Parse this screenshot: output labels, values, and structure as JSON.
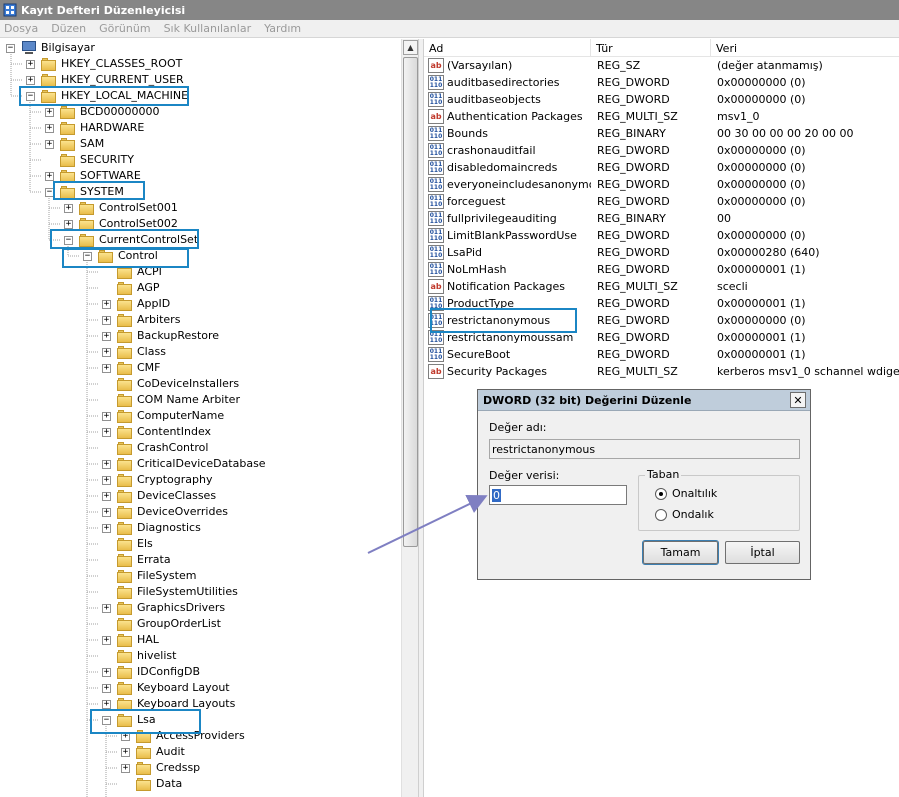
{
  "window": {
    "title": "Kayıt Defteri Düzenleyicisi"
  },
  "menu": [
    "Dosya",
    "Düzen",
    "Görünüm",
    "Sık Kullanılanlar",
    "Yardım"
  ],
  "tree": {
    "root": "Bilgisayar",
    "hives": [
      "HKEY_CLASSES_ROOT",
      "HKEY_CURRENT_USER",
      "HKEY_LOCAL_MACHINE"
    ],
    "hklm_children": [
      "BCD00000000",
      "HARDWARE",
      "SAM",
      "SECURITY",
      "SOFTWARE",
      "SYSTEM"
    ],
    "system_children": [
      "ControlSet001",
      "ControlSet002",
      "CurrentControlSet"
    ],
    "ccs_children": [
      "Control"
    ],
    "control_children": [
      "ACPI",
      "AGP",
      "AppID",
      "Arbiters",
      "BackupRestore",
      "Class",
      "CMF",
      "CoDeviceInstallers",
      "COM Name Arbiter",
      "ComputerName",
      "ContentIndex",
      "CrashControl",
      "CriticalDeviceDatabase",
      "Cryptography",
      "DeviceClasses",
      "DeviceOverrides",
      "Diagnostics",
      "Els",
      "Errata",
      "FileSystem",
      "FileSystemUtilities",
      "GraphicsDrivers",
      "GroupOrderList",
      "HAL",
      "hivelist",
      "IDConfigDB",
      "Keyboard Layout",
      "Keyboard Layouts",
      "Lsa"
    ],
    "lsa_children": [
      "AccessProviders",
      "Audit",
      "Credssp",
      "Data"
    ]
  },
  "list": {
    "columns": [
      "Ad",
      "Tür",
      "Veri"
    ],
    "rows": [
      {
        "name": "(Varsayılan)",
        "type": "REG_SZ",
        "data": "(değer atanmamış)",
        "icon": "string-value-icon"
      },
      {
        "name": "auditbasedirectories",
        "type": "REG_DWORD",
        "data": "0x00000000 (0)",
        "icon": "binary-value-icon"
      },
      {
        "name": "auditbaseobjects",
        "type": "REG_DWORD",
        "data": "0x00000000 (0)",
        "icon": "binary-value-icon"
      },
      {
        "name": "Authentication Packages",
        "type": "REG_MULTI_SZ",
        "data": "msv1_0",
        "icon": "string-value-icon"
      },
      {
        "name": "Bounds",
        "type": "REG_BINARY",
        "data": "00 30 00 00 00 20 00 00",
        "icon": "binary-value-icon"
      },
      {
        "name": "crashonauditfail",
        "type": "REG_DWORD",
        "data": "0x00000000 (0)",
        "icon": "binary-value-icon"
      },
      {
        "name": "disabledomaincreds",
        "type": "REG_DWORD",
        "data": "0x00000000 (0)",
        "icon": "binary-value-icon"
      },
      {
        "name": "everyoneincludesanonymous",
        "type": "REG_DWORD",
        "data": "0x00000000 (0)",
        "icon": "binary-value-icon"
      },
      {
        "name": "forceguest",
        "type": "REG_DWORD",
        "data": "0x00000000 (0)",
        "icon": "binary-value-icon"
      },
      {
        "name": "fullprivilegeauditing",
        "type": "REG_BINARY",
        "data": "00",
        "icon": "binary-value-icon"
      },
      {
        "name": "LimitBlankPasswordUse",
        "type": "REG_DWORD",
        "data": "0x00000000 (0)",
        "icon": "binary-value-icon"
      },
      {
        "name": "LsaPid",
        "type": "REG_DWORD",
        "data": "0x00000280 (640)",
        "icon": "binary-value-icon"
      },
      {
        "name": "NoLmHash",
        "type": "REG_DWORD",
        "data": "0x00000001 (1)",
        "icon": "binary-value-icon"
      },
      {
        "name": "Notification Packages",
        "type": "REG_MULTI_SZ",
        "data": "scecli",
        "icon": "string-value-icon"
      },
      {
        "name": "ProductType",
        "type": "REG_DWORD",
        "data": "0x00000001 (1)",
        "icon": "binary-value-icon"
      },
      {
        "name": "restrictanonymous",
        "type": "REG_DWORD",
        "data": "0x00000000 (0)",
        "icon": "binary-value-icon"
      },
      {
        "name": "restrictanonymoussam",
        "type": "REG_DWORD",
        "data": "0x00000001 (1)",
        "icon": "binary-value-icon"
      },
      {
        "name": "SecureBoot",
        "type": "REG_DWORD",
        "data": "0x00000001 (1)",
        "icon": "binary-value-icon"
      },
      {
        "name": "Security Packages",
        "type": "REG_MULTI_SZ",
        "data": "kerberos msv1_0 schannel wdigest tspkg",
        "icon": "string-value-icon"
      }
    ]
  },
  "dialog": {
    "title": "DWORD (32 bit) Değerini Düzenle",
    "close": "✕",
    "name_label": "Değer adı:",
    "name_value": "restrictanonymous",
    "data_label": "Değer verisi:",
    "data_value": "0",
    "base_label": "Taban",
    "hex_label": "Onaltılık",
    "dec_label": "Ondalık",
    "base_selected": "Onaltılık",
    "ok_label": "Tamam",
    "cancel_label": "İptal"
  },
  "accent_color": "#1b86c4",
  "arrow_color": "#7f7fc2"
}
